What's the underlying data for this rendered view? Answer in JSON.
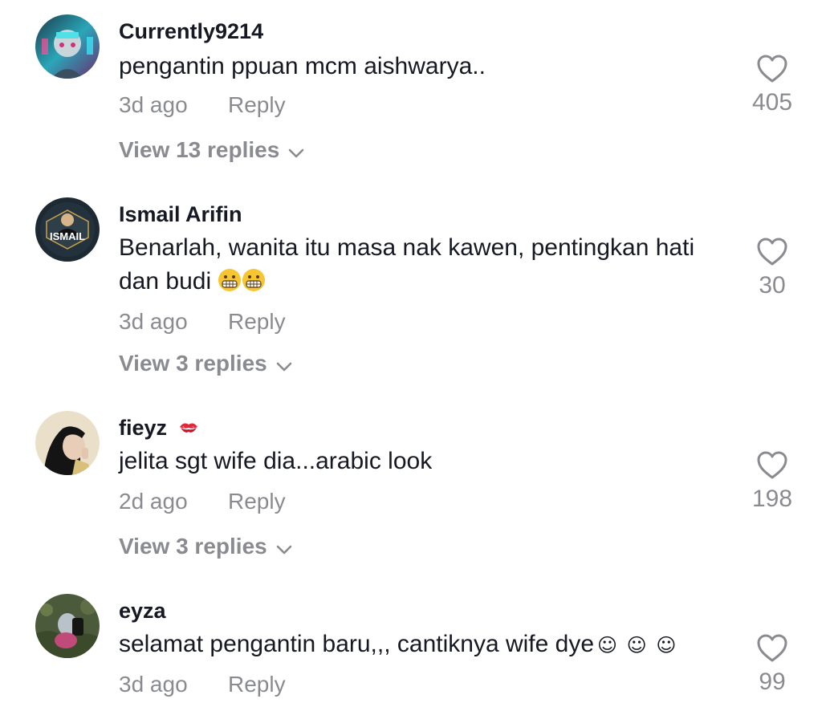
{
  "comments": [
    {
      "username": "Currently9214",
      "text": "pengantin ppuan mcm aishwarya..",
      "time": "3d ago",
      "reply_label": "Reply",
      "likes": "405",
      "view_replies": "View 13 replies"
    },
    {
      "username": "Ismail Arifin",
      "text": "Benarlah, wanita itu masa nak kawen, pentingkan hati dan budi",
      "emoji": "grimacing-face x2",
      "time": "3d ago",
      "reply_label": "Reply",
      "likes": "30",
      "view_replies": "View 3 replies",
      "avatar_logo_text": "ISMAIL"
    },
    {
      "username": "fieyz",
      "username_emoji": "kiss-mark",
      "text": "jelita sgt wife dia...arabic look",
      "time": "2d ago",
      "reply_label": "Reply",
      "likes": "198",
      "view_replies": "View 3 replies"
    },
    {
      "username": "eyza",
      "text": "selamat pengantin baru,,, cantiknya wife dye",
      "text_suffix": "☺ ☺ ☺",
      "time": "3d ago",
      "reply_label": "Reply",
      "likes": "99"
    }
  ],
  "icons": {
    "like": "heart-outline-icon",
    "expand": "chevron-down-icon"
  },
  "colors": {
    "primary_text": "#161823",
    "secondary_text": "#8a8b91"
  }
}
